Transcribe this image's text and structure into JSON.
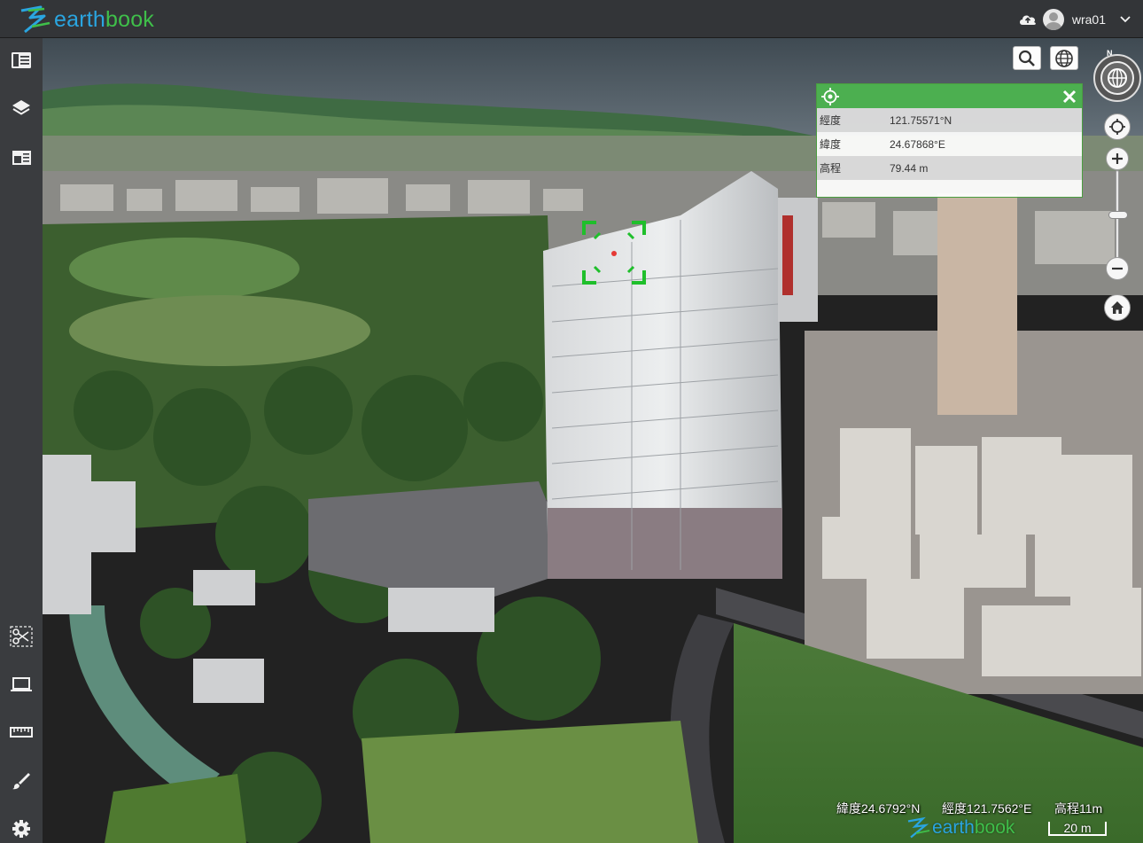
{
  "app": {
    "logo_text_a": "earth",
    "logo_text_b": "book",
    "username": "wra01"
  },
  "icons": {
    "upload": "cloud-upload-icon",
    "avatar": "user-avatar-icon",
    "dropdown": "chevron-down-icon",
    "search": "search-icon",
    "globe": "globe-icon",
    "compass": "compass-icon",
    "locate": "crosshair-icon",
    "zoom_in": "plus-icon",
    "zoom_out": "minus-icon",
    "home": "home-icon",
    "close": "close-icon"
  },
  "sidebar": {
    "items": [
      {
        "name": "panel-toggle-icon"
      },
      {
        "name": "layers-icon"
      },
      {
        "name": "reader-icon"
      },
      {
        "name": "scissors-icon"
      },
      {
        "name": "monitor-icon"
      },
      {
        "name": "ruler-icon"
      },
      {
        "name": "brush-icon"
      },
      {
        "name": "gear-icon"
      }
    ]
  },
  "info_panel": {
    "rows": [
      {
        "label": "經度",
        "value": "121.75571°N"
      },
      {
        "label": "緯度",
        "value": "24.67868°E"
      },
      {
        "label": "高程",
        "value": "79.44 m"
      }
    ]
  },
  "compass": {
    "north_label": "N"
  },
  "status": {
    "lat": "緯度24.6792°N",
    "lon": "經度121.7562°E",
    "elev": "高程11m",
    "scale": "20 m"
  },
  "colors": {
    "accent_green": "#4caf50",
    "topbar": "#333538",
    "sidebar": "#3a3c3f",
    "logo_blue": "#2aa5e0",
    "logo_green": "#3fbf4a"
  }
}
